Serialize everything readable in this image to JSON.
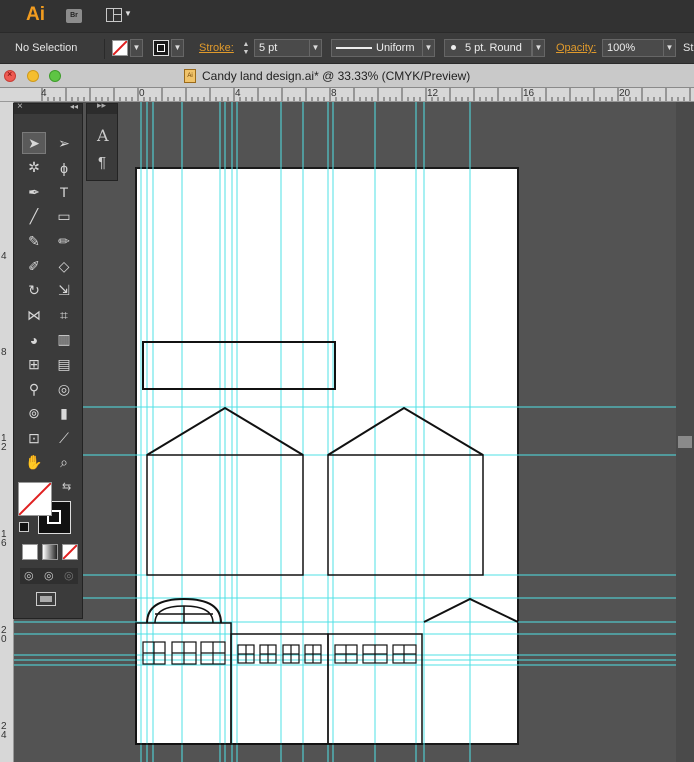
{
  "app": {
    "logo": "Ai",
    "bridge": "Br"
  },
  "control_bar": {
    "selection": "No Selection",
    "stroke_label": "Stroke:",
    "stroke_weight": "5 pt",
    "stroke_profile": "Uniform",
    "brush": "5 pt. Round",
    "opacity_label": "Opacity:",
    "opacity": "100%",
    "style_label": "St"
  },
  "document": {
    "title": "Candy land design.ai* @ 33.33% (CMYK/Preview)",
    "icon": "Ai"
  },
  "ruler": {
    "h_labels": [
      "4",
      "0",
      "4",
      "8",
      "12",
      "16",
      "20"
    ],
    "v_labels": [
      "4",
      "8",
      "1 2",
      "1 6",
      "2 0",
      "2 4"
    ]
  },
  "tools_panel": {
    "tools": [
      "selection-tool-icon",
      "direct-selection-tool-icon",
      "magic-wand-tool-icon",
      "lasso-tool-icon",
      "pen-tool-icon",
      "type-tool-icon",
      "line-segment-tool-icon",
      "rectangle-tool-icon",
      "paintbrush-tool-icon",
      "pencil-tool-icon",
      "blob-brush-tool-icon",
      "eraser-tool-icon",
      "rotate-tool-icon",
      "scale-tool-icon",
      "width-tool-icon",
      "free-transform-tool-icon",
      "shape-builder-tool-icon",
      "perspective-grid-tool-icon",
      "mesh-tool-icon",
      "gradient-tool-icon",
      "eyedropper-tool-icon",
      "blend-tool-icon",
      "symbol-sprayer-tool-icon",
      "column-graph-tool-icon",
      "artboard-tool-icon",
      "slice-tool-icon",
      "hand-tool-icon",
      "zoom-tool-icon"
    ]
  },
  "colors": {
    "guide": "#4fe0e6",
    "accent": "#e09a2c",
    "logo": "#f29c1f"
  }
}
